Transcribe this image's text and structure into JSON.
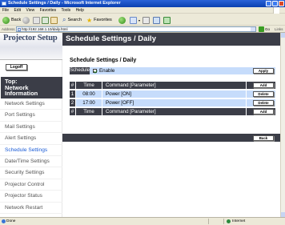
{
  "window": {
    "title": "Schedule Settings / Daily - Microsoft Internet Explorer"
  },
  "menu": [
    "File",
    "Edit",
    "View",
    "Favorites",
    "Tools",
    "Help"
  ],
  "toolbar": {
    "back_label": "Back",
    "search_label": "Search",
    "favorites_label": "Favorites"
  },
  "address": {
    "label": "Address",
    "url": "http://192.168.1.10/daily.html",
    "go_label": "Go",
    "links_label": "Links"
  },
  "sidebar": {
    "logo": "Projector Setup",
    "logoff": "Logoff",
    "top_network_line1": "Top:",
    "top_network_line2": "Network",
    "top_network_line3": "Information",
    "items": [
      {
        "label": "Network Settings"
      },
      {
        "label": "Port Settings"
      },
      {
        "label": "Mail Settings"
      },
      {
        "label": "Alert Settings"
      },
      {
        "label": "Schedule Settings"
      },
      {
        "label": "Date/Time Settings"
      },
      {
        "label": "Security Settings"
      },
      {
        "label": "Projector Control"
      },
      {
        "label": "Projector Status"
      },
      {
        "label": "Network Restart"
      }
    ]
  },
  "main": {
    "header": "Schedule Settings / Daily",
    "subtitle": "Schedule Settings / Daily",
    "schedule_label": "Schedule",
    "enable_label": "Enable",
    "enable_checked": true,
    "apply_label": "Apply",
    "table": {
      "columns": [
        "#",
        "Time",
        "Command [Parameter]"
      ],
      "rows": [
        {
          "num": "1",
          "time": "08:00",
          "command": "Power [ON]",
          "action": "Delete"
        },
        {
          "num": "2",
          "time": "17:00",
          "command": "Power [OFF]",
          "action": "Delete"
        }
      ],
      "add_label": "Add"
    },
    "back_label": "Back"
  },
  "status": {
    "text": "Done",
    "zone": "Internet"
  },
  "colors": {
    "dark_band": "#3b3d47",
    "light_blue": "#c6dcfb",
    "active_link": "#1a5bd6"
  }
}
